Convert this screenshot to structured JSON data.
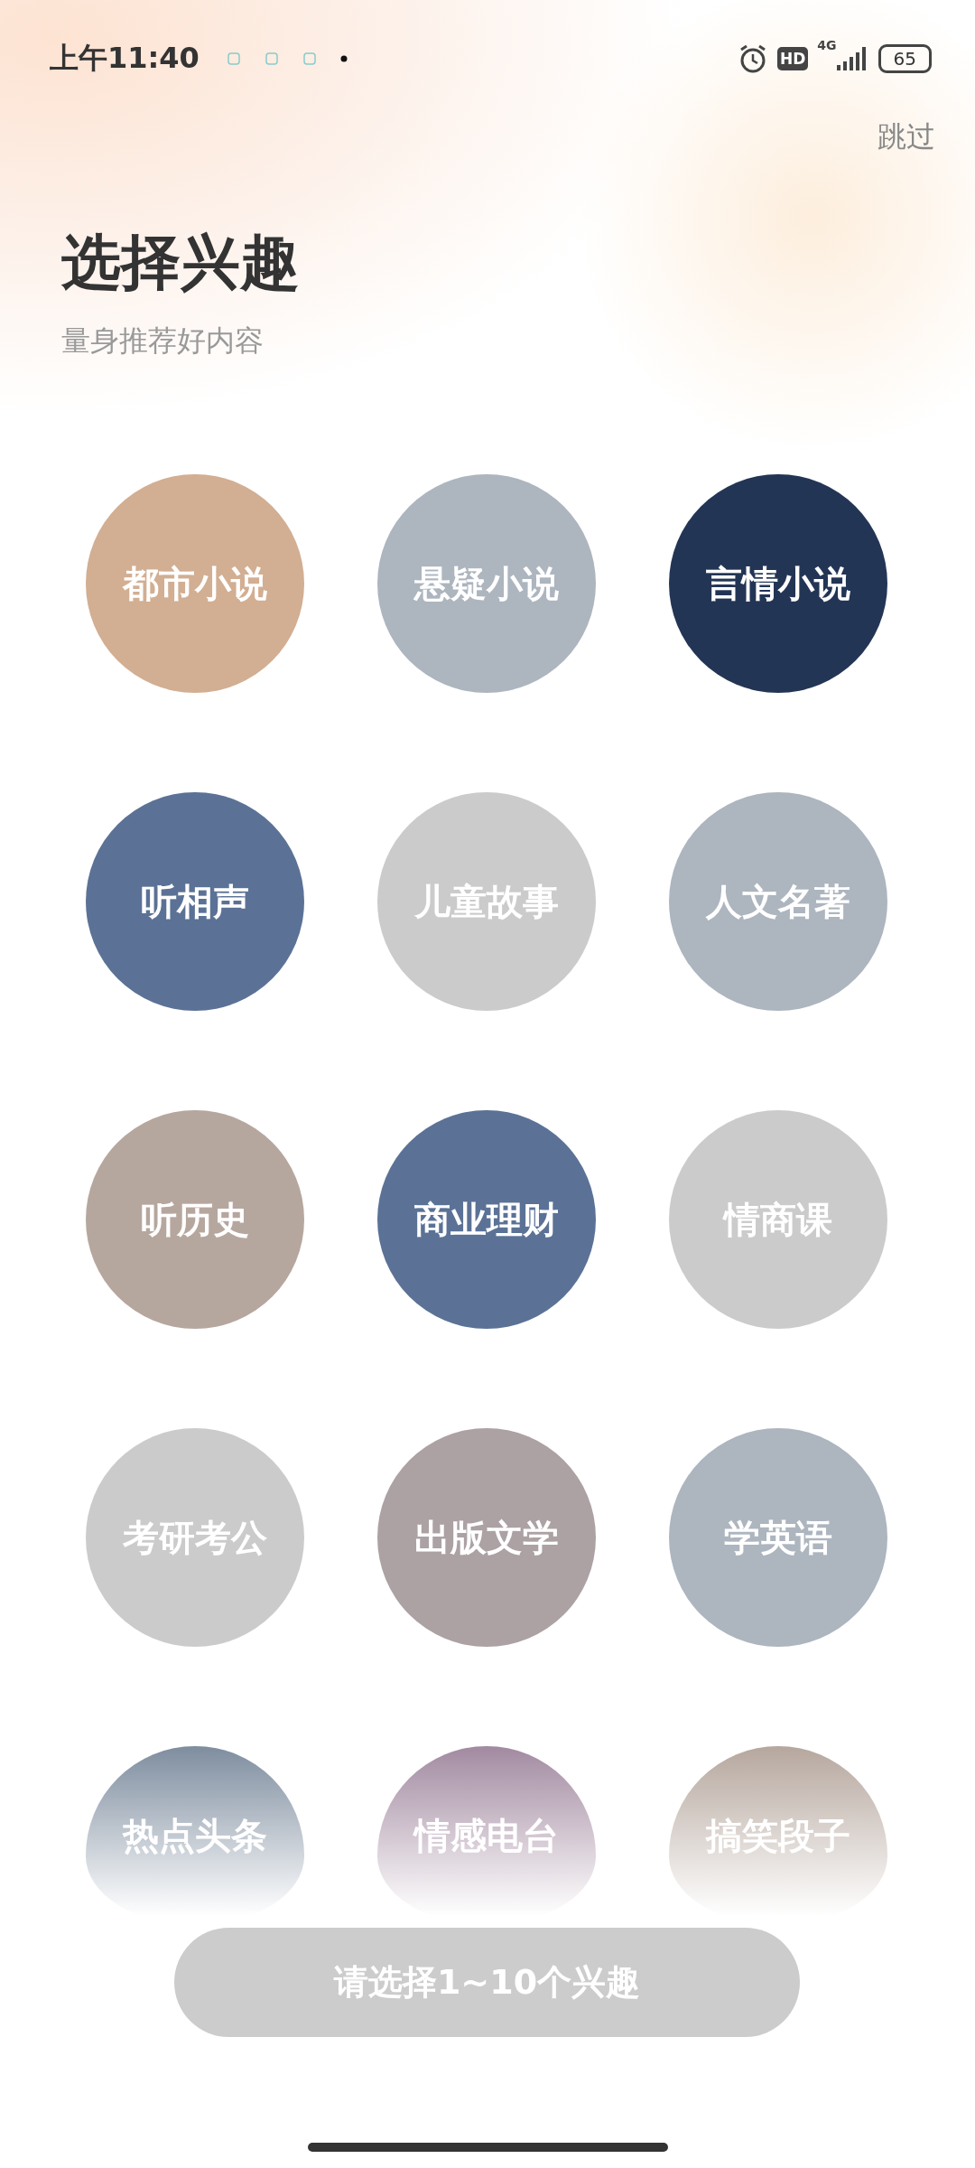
{
  "status_bar": {
    "time": "上午11:40",
    "hd": "HD",
    "network": "4G",
    "battery": "65"
  },
  "skip": "跳过",
  "title": "选择兴趣",
  "subtitle": "量身推荐好内容",
  "interests": [
    {
      "label": "都市小说",
      "color": "#d2ae92"
    },
    {
      "label": "悬疑小说",
      "color": "#adb5bf"
    },
    {
      "label": "言情小说",
      "color": "#233555"
    },
    {
      "label": "听相声",
      "color": "#5b7296"
    },
    {
      "label": "儿童故事",
      "color": "#cbcbcb"
    },
    {
      "label": "人文名著",
      "color": "#adb5bf"
    },
    {
      "label": "听历史",
      "color": "#b6a79e"
    },
    {
      "label": "商业理财",
      "color": "#5b7296"
    },
    {
      "label": "情商课",
      "color": "#cbcbcb"
    },
    {
      "label": "考研考公",
      "color": "#cbcbcb"
    },
    {
      "label": "出版文学",
      "color": "#aca1a3"
    },
    {
      "label": "学英语",
      "color": "#adb5bf"
    },
    {
      "label": "热点头条",
      "color": "#7e8d9f"
    },
    {
      "label": "情感电台",
      "color": "#a28aa1"
    },
    {
      "label": "搞笑段子",
      "color": "#b6a79e"
    }
  ],
  "confirm_button": "请选择1~10个兴趣"
}
